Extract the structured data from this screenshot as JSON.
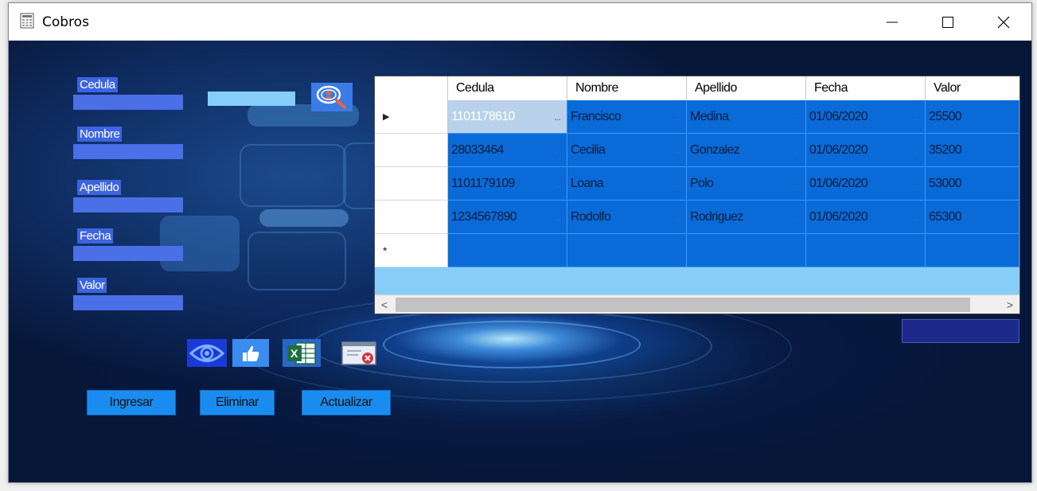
{
  "window": {
    "title": "Cobros",
    "icon": "grid-app-icon",
    "controls": [
      "minimize-icon",
      "maximize-icon",
      "close-icon"
    ]
  },
  "form": {
    "cedula_label": "Cedula",
    "nombre_label": "Nombre",
    "apellido_label": "Apellido",
    "fecha_label": "Fecha",
    "valor_label": "Valor",
    "cedula_value": "",
    "nombre_value": "",
    "apellido_value": "",
    "fecha_value": "",
    "valor_value": "",
    "search_value": "",
    "search_icon": "search-user-icon"
  },
  "icon_buttons": [
    "eye-icon",
    "thumbs-up-icon",
    "excel-icon",
    "close-window-icon"
  ],
  "buttons": {
    "ingresar": "Ingresar",
    "eliminar": "Eliminar",
    "actualizar": "Actualizar"
  },
  "total_value": "",
  "grid": {
    "columns": [
      "Cedula",
      "Nombre",
      "Apellido",
      "Fecha",
      "Valor"
    ],
    "rows": [
      [
        "1101178610",
        "Francisco",
        "Medina",
        "01/06/2020",
        "25500"
      ],
      [
        "28033464",
        "Cecilia",
        "Gonzalez",
        "01/06/2020",
        "35200"
      ],
      [
        "1101179109",
        "Loana",
        "Polo",
        "01/06/2020",
        "53000"
      ],
      [
        "1234567890",
        "Rodolfo",
        "Rodriguez",
        "01/06/2020",
        "65300"
      ]
    ],
    "current_row_marker": "▶",
    "new_row_marker": "*",
    "ellipsis": "..."
  },
  "colors": {
    "cell_bg": "#0a6ad8",
    "label_bg": "#3c64e0",
    "button_bg": "#1a8cf0",
    "grid_bg": "#87cdfa"
  }
}
